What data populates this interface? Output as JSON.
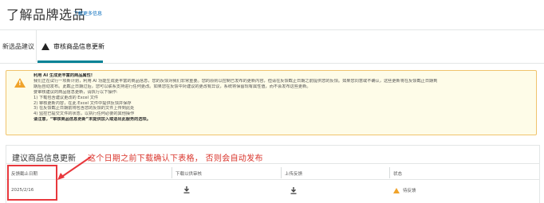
{
  "header": {
    "title": "了解品牌选品",
    "learn_more": "了解更多信息"
  },
  "tabs": [
    {
      "label": "新选品建议",
      "active": false
    },
    {
      "label": "审核商品信息更新",
      "active": true,
      "icon": "warning-icon"
    }
  ],
  "alert": {
    "icon": "warning-icon",
    "lines": [
      {
        "text": "利用 AI 生成更丰富的商品属性!",
        "bold": true
      },
      {
        "text": "我们正在试行一项新计划，利用 AI 功能生成更丰富的商品信息，您的反馈对我们非常重要。您的原则以控制已发布的更新内容，但请在反馈截止日期之前提供您的反馈。如果您同意或不确认，这些更新将在反馈截止日期到",
        "bold": false
      },
      {
        "text": "期后自动发布。此截止日期过后，您可以联系支持进行任何更改。如果您在反馈中对建议的更改有异议，系统将保留现有属性值，而不会发布这些更新。",
        "bold": false
      },
      {
        "text": "要审核建议的商品信息更新，请执行以下操作:",
        "bold": false
      },
      {
        "text": "1) 下载包含建议更改的 Excel 文件",
        "bold": false
      },
      {
        "text": "2) 审核更新内容，在此 Excel 文件中提供反馈并保存",
        "bold": false
      },
      {
        "text": "3) 在反馈截止日期前将包含您的反馈的文件上传到此处",
        "bold": false
      },
      {
        "text": "4) 监控已提交文件的状态，以执行任何必要的其他操作",
        "bold": false
      },
      {
        "text": "请注意，“审核商品信息更新”未提供加入或退出此服务的选项。",
        "bold": true
      }
    ]
  },
  "section": {
    "title": "建议商品信息更新",
    "annotation": "这个日期之前下载确认下表格， 否则会自动发布"
  },
  "table": {
    "columns": [
      "反馈截止日期",
      "下载以供审核",
      "上传反馈",
      "状态"
    ],
    "rows": [
      {
        "deadline": "2025/2/16",
        "download_icon": "download-icon",
        "upload_icon": "upload-icon",
        "status": "待反馈",
        "status_icon": "warning-icon"
      }
    ]
  },
  "colors": {
    "accent": "#008296",
    "alert_bg": "#fefce8",
    "alert_border": "#f0c36d",
    "warning": "#f0a32b",
    "annotation_red": "#e8383d"
  }
}
